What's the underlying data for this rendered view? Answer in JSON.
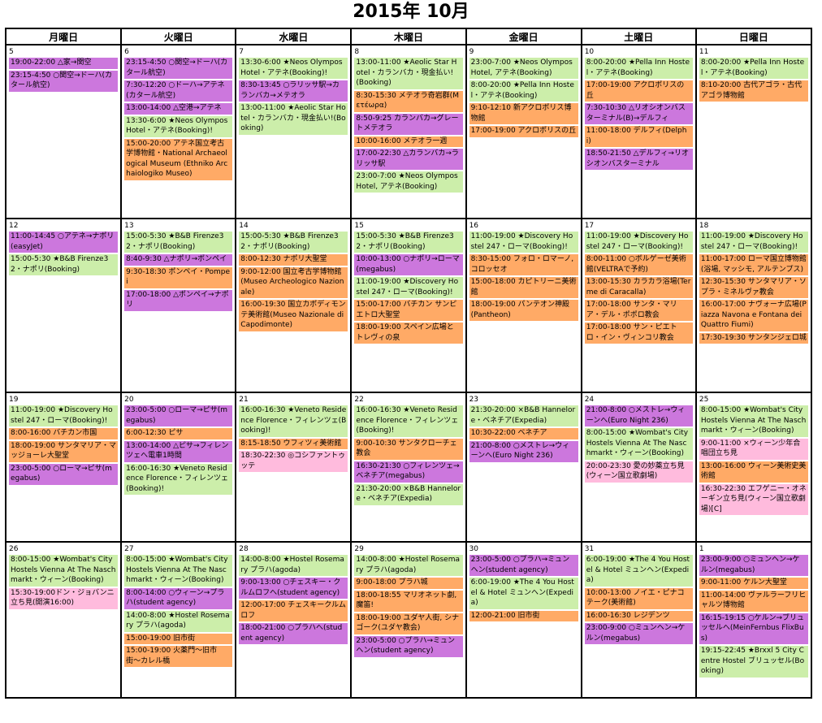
{
  "title": "2015年 10月",
  "weekdays": [
    "月曜日",
    "火曜日",
    "水曜日",
    "木曜日",
    "金曜日",
    "土曜日",
    "日曜日"
  ],
  "colors": {
    "purple": "#cc77dd",
    "green": "#cceeaa",
    "orange": "#ffaa66",
    "pink": "#ffbbdd"
  },
  "weeks": [
    [
      {
        "day": "5",
        "events": [
          {
            "color": "purple",
            "text": "19:00-22:00 △家→関空"
          },
          {
            "color": "purple",
            "text": "23:15-4:50 ○関空→ドーハ(カタール航空)"
          }
        ]
      },
      {
        "day": "6",
        "events": [
          {
            "color": "purple",
            "text": "23:15-4:50 ○関空→ドーハ(カタール航空)"
          },
          {
            "color": "purple",
            "text": "7:30-12:20 ○ドーハ→アテネ(カタール航空)"
          },
          {
            "color": "purple",
            "text": "13:00-14:00 △空港→アテネ"
          },
          {
            "color": "green",
            "text": "13:30-6:00 ★Neos Olympos Hotel・アテネ(Booking)!"
          },
          {
            "color": "orange",
            "text": "15:00-20:00 アテネ国立考古学博物館・National Archaeological Museum (Ethniko Archaiologiko Museo)"
          }
        ]
      },
      {
        "day": "7",
        "events": [
          {
            "color": "green",
            "text": "13:30-6:00 ★Neos Olympos Hotel・アテネ(Booking)!"
          },
          {
            "color": "purple",
            "text": "8:30-13:45 ○ラリッサ駅→カランバカ→メテオラ"
          },
          {
            "color": "green",
            "text": "13:00-11:00 ★Aeolic Star Hotel・カランバカ・現金払い!(Booking)"
          }
        ]
      },
      {
        "day": "8",
        "events": [
          {
            "color": "green",
            "text": "13:00-11:00 ★Aeolic Star Hotel・カランバカ・現金払い!(Booking)"
          },
          {
            "color": "orange",
            "text": "8:30-15:30 メテオラ奇岩群(Μετέωρα)"
          },
          {
            "color": "purple",
            "text": "8:50-9:25 カランバカ→グレートメテオラ"
          },
          {
            "color": "orange",
            "text": "10:00-16:00 メテオラ一週"
          },
          {
            "color": "purple",
            "text": "17:00-22:30 △カランバカ→ラリッサ駅"
          },
          {
            "color": "green",
            "text": "23:00-7:00 ★Neos Olympos Hotel, アテネ(Booking)"
          }
        ]
      },
      {
        "day": "9",
        "events": [
          {
            "color": "green",
            "text": "23:00-7:00 ★Neos Olympos Hotel, アテネ(Booking)"
          },
          {
            "color": "green",
            "text": "8:00-20:00 ★Pella Inn Hostel・アテネ(Booking)"
          },
          {
            "color": "orange",
            "text": "9:10-12:10 新アクロポリス博物館"
          },
          {
            "color": "orange",
            "text": "17:00-19:00 アクロポリスの丘"
          }
        ]
      },
      {
        "day": "10",
        "events": [
          {
            "color": "green",
            "text": "8:00-20:00 ★Pella Inn Hostel・アテネ(Booking)"
          },
          {
            "color": "orange",
            "text": "17:00-19:00 アクロポリスの丘"
          },
          {
            "color": "purple",
            "text": "7:30-10:30 △リオシオンバスターミナル(B)→デルフィ"
          },
          {
            "color": "orange",
            "text": "11:00-18:00 デルフィ(Delphi)"
          },
          {
            "color": "purple",
            "text": "18:50-21:50 △デルフィ→リオシオンバスターミナル"
          }
        ]
      },
      {
        "day": "11",
        "events": [
          {
            "color": "green",
            "text": "8:00-20:00 ★Pella Inn Hostel・アテネ(Booking)"
          },
          {
            "color": "orange",
            "text": "8:10-20:00 古代アゴラ・古代アゴラ博物館"
          }
        ]
      }
    ],
    [
      {
        "day": "12",
        "events": [
          {
            "color": "purple",
            "text": "11:00-14:45 ○アテネ→ナポリ(easyJet)"
          },
          {
            "color": "green",
            "text": "15:00-5:30 ★B&B Firenze32・ナポリ(Booking)"
          }
        ]
      },
      {
        "day": "13",
        "events": [
          {
            "color": "green",
            "text": "15:00-5:30 ★B&B Firenze32・ナポリ(Booking)"
          },
          {
            "color": "purple",
            "text": "8:40-9:30 △ナポリ→ポンペイ"
          },
          {
            "color": "orange",
            "text": "9:30-18:30 ポンペイ・Pompei"
          },
          {
            "color": "purple",
            "text": "17:00-18:00 △ポンペイ→ナポリ"
          }
        ]
      },
      {
        "day": "14",
        "events": [
          {
            "color": "green",
            "text": "15:00-5:30 ★B&B Firenze32・ナポリ(Booking)"
          },
          {
            "color": "orange",
            "text": "8:00-12:30 ナポリ大聖堂"
          },
          {
            "color": "orange",
            "text": "9:00-12:00 国立考古学博物館(Museo Archeologico Nazionale)"
          },
          {
            "color": "orange",
            "text": "16:00-19:30 国立カポディモンテ美術館(Museo Nazionale di Capodimonte)"
          }
        ]
      },
      {
        "day": "15",
        "events": [
          {
            "color": "green",
            "text": "15:00-5:30 ★B&B Firenze32・ナポリ(Booking)"
          },
          {
            "color": "purple",
            "text": "10:00-13:00 ○ナポリ→ローマ(megabus)"
          },
          {
            "color": "green",
            "text": "11:00-19:00 ★Discovery Hostel 247・ローマ(Booking)!"
          },
          {
            "color": "orange",
            "text": "15:00-17:00 バチカン サンピエトロ大聖堂"
          },
          {
            "color": "orange",
            "text": "18:00-19:00 スペイン広場とトレヴィの泉"
          }
        ]
      },
      {
        "day": "16",
        "events": [
          {
            "color": "green",
            "text": "11:00-19:00 ★Discovery Hostel 247・ローマ(Booking)!"
          },
          {
            "color": "orange",
            "text": "8:30-15:00 フォロ・ロマーノ, コロッセオ"
          },
          {
            "color": "orange",
            "text": "15:00-18:00 カピトリーニ美術館"
          },
          {
            "color": "orange",
            "text": "18:00-19:00 パンテオン神殿(Pantheon)"
          }
        ]
      },
      {
        "day": "17",
        "events": [
          {
            "color": "green",
            "text": "11:00-19:00 ★Discovery Hostel 247・ローマ(Booking)!"
          },
          {
            "color": "orange",
            "text": "8:00-11:00 ○ボルゲーゼ美術館(VELTRAで予約)"
          },
          {
            "color": "orange",
            "text": "13:00-15:30 カラカラ浴場(Terme di Caracalla)"
          },
          {
            "color": "orange",
            "text": "17:00-18:00 サンタ・マリア・デル・ポポロ教会"
          },
          {
            "color": "orange",
            "text": "17:00-18:00 サン・ピエトロ・イン・ヴィンコリ教会"
          }
        ]
      },
      {
        "day": "18",
        "events": [
          {
            "color": "green",
            "text": "11:00-19:00 ★Discovery Hostel 247・ローマ(Booking)!"
          },
          {
            "color": "orange",
            "text": "11:00-17:00 ローマ国立博物館(浴場, マッシモ, アルテンプス)"
          },
          {
            "color": "orange",
            "text": "12:30-15:30 サンタマリア・ソプラ・ミネルヴァ教会"
          },
          {
            "color": "orange",
            "text": "16:00-17:00 ナヴォーナ広場(Piazza Navona e Fontana dei Quattro Fiumi)"
          },
          {
            "color": "orange",
            "text": "17:30-19:30 サンタンジェロ城"
          }
        ]
      }
    ],
    [
      {
        "day": "19",
        "events": [
          {
            "color": "green",
            "text": "11:00-19:00 ★Discovery Hostel 247・ローマ(Booking)!"
          },
          {
            "color": "orange",
            "text": "8:00-16:00 バチカン市国"
          },
          {
            "color": "orange",
            "text": "18:00-19:00 サンタマリア・マッジョーレ大聖堂"
          },
          {
            "color": "purple",
            "text": "23:00-5:00 ○ローマ→ピサ(megabus)"
          }
        ]
      },
      {
        "day": "20",
        "events": [
          {
            "color": "purple",
            "text": "23:00-5:00 ○ローマ→ピサ(megabus)"
          },
          {
            "color": "orange",
            "text": "6:00-12:30 ピサ"
          },
          {
            "color": "purple",
            "text": "13:00-14:00 △ピサ→フィレンツェへ電車1時間"
          },
          {
            "color": "green",
            "text": "16:00-16:30 ★Veneto Residence Florence・フィレンツェ(Booking)!"
          }
        ]
      },
      {
        "day": "21",
        "events": [
          {
            "color": "green",
            "text": "16:00-16:30 ★Veneto Residence Florence・フィレンツェ(Booking)!"
          },
          {
            "color": "orange",
            "text": "8:15-18:50 ウフィツィ美術館"
          },
          {
            "color": "pink",
            "text": "18:30-22:30 ◎コシファントゥッテ"
          }
        ]
      },
      {
        "day": "22",
        "events": [
          {
            "color": "green",
            "text": "16:00-16:30 ★Veneto Residence Florence・フィレンツェ(Booking)!"
          },
          {
            "color": "orange",
            "text": "9:00-10:30 サンタクローチェ教会"
          },
          {
            "color": "purple",
            "text": "16:30-21:30 ○フィレンツェ→ベネチア(megabus)"
          },
          {
            "color": "green",
            "text": "21:30-20:00 ×B&B Hannelore・ベネチア(Expedia)"
          }
        ]
      },
      {
        "day": "23",
        "events": [
          {
            "color": "green",
            "text": "21:30-20:00 ×B&B Hannelore・ベネチア(Expedia)"
          },
          {
            "color": "orange",
            "text": "10:30-22:00 ベネチア"
          },
          {
            "color": "purple",
            "text": "21:00-8:00 ○メストレ→ウィーンへ(Euro Night 236)"
          }
        ]
      },
      {
        "day": "24",
        "events": [
          {
            "color": "purple",
            "text": "21:00-8:00 ○メストレ→ウィーンへ(Euro Night 236)"
          },
          {
            "color": "green",
            "text": "8:00-15:00 ★Wombat's City Hostels Vienna At The Naschmarkt・ウィーン(Booking)"
          },
          {
            "color": "pink",
            "text": "20:00-23:30 愛の妙薬立ち見(ウィーン国立歌劇場)"
          }
        ]
      },
      {
        "day": "25",
        "events": [
          {
            "color": "green",
            "text": "8:00-15:00 ★Wombat's City Hostels Vienna At The Naschmarkt・ウィーン(Booking)"
          },
          {
            "color": "pink",
            "text": "9:00-11:00 ×ウィーン少年合唱団立ち見"
          },
          {
            "color": "orange",
            "text": "13:00-16:00 ウィーン美術史美術館"
          },
          {
            "color": "pink",
            "text": "16:30-22:30 エフゲニー・オネーギン立ち見(ウィーン国立歌劇場)[C]"
          }
        ]
      }
    ],
    [
      {
        "day": "26",
        "events": [
          {
            "color": "green",
            "text": "8:00-15:00 ★Wombat's City Hostels Vienna At The Naschmarkt・ウィーン(Booking)"
          },
          {
            "color": "pink",
            "text": "15:30-19:00ドン・ジョバンニ立ち見(開演16:00)"
          }
        ]
      },
      {
        "day": "27",
        "events": [
          {
            "color": "green",
            "text": "8:00-15:00 ★Wombat's City Hostels Vienna At The Naschmarkt・ウィーン(Booking)"
          },
          {
            "color": "purple",
            "text": "8:00-14:00 ○ウィーン→プラハ(student agency)"
          },
          {
            "color": "green",
            "text": "14:00-8:00 ★Hostel Rosemary プラハ(agoda)"
          },
          {
            "color": "orange",
            "text": "15:00-19:00 旧市街"
          },
          {
            "color": "orange",
            "text": "15:00-19:00 火薬門〜旧市街〜カレル橋"
          }
        ]
      },
      {
        "day": "28",
        "events": [
          {
            "color": "green",
            "text": "14:00-8:00 ★Hostel Rosemary プラハ(agoda)"
          },
          {
            "color": "purple",
            "text": "9:00-13:00 ○チェスキー・クルムロフへ(student agency)"
          },
          {
            "color": "orange",
            "text": "12:00-17:00 チェスキークルムロフ"
          },
          {
            "color": "purple",
            "text": "18:00-21:00 ○プラハへ(student agency)"
          }
        ]
      },
      {
        "day": "29",
        "events": [
          {
            "color": "green",
            "text": "14:00-8:00 ★Hostel Rosemary プラハ(agoda)"
          },
          {
            "color": "orange",
            "text": "9:00-18:00 プラハ城"
          },
          {
            "color": "orange",
            "text": "18:00-18:55 マリオネット劇, 魔笛!"
          },
          {
            "color": "orange",
            "text": "18:00-19:00 ユダヤ人街, シナゴーク(ユダヤ教会)"
          },
          {
            "color": "purple",
            "text": "23:00-5:00 ○プラハ→ミュンヘン(student agency)"
          }
        ]
      },
      {
        "day": "30",
        "events": [
          {
            "color": "purple",
            "text": "23:00-5:00 ○プラハ→ミュンヘン(student agency)"
          },
          {
            "color": "green",
            "text": "6:00-19:00 ★The 4 You Hostel & Hotel ミュンヘン(Expedia)"
          },
          {
            "color": "orange",
            "text": "12:00-21:00 旧市街"
          }
        ]
      },
      {
        "day": "31",
        "events": [
          {
            "color": "green",
            "text": "6:00-19:00 ★The 4 You Hostel & Hotel ミュンヘン(Expedia)"
          },
          {
            "color": "orange",
            "text": "10:00-13:00 ノイエ・ピナコテーク(美術館)"
          },
          {
            "color": "orange",
            "text": "16:00-16:30 レジデンツ"
          },
          {
            "color": "purple",
            "text": "23:00-9:00 ○ミュンヘン→ケルン(megabus)"
          }
        ]
      },
      {
        "day": "1",
        "events": [
          {
            "color": "purple",
            "text": "23:00-9:00 ○ミュンヘン→ケルン(megabus)"
          },
          {
            "color": "orange",
            "text": "9:00-11:00 ケルン大聖堂"
          },
          {
            "color": "orange",
            "text": "11:00-14:00 ヴァルラーフリヒャルツ博物館"
          },
          {
            "color": "purple",
            "text": "16:15-19:15 ○ケルン→ブリュッセルへ(MeinFernbus FlixBus)"
          },
          {
            "color": "green",
            "text": "19:15-22:45 ★Brxxl 5 City Centre Hostel ブリュッセル(Booking)"
          }
        ]
      }
    ]
  ]
}
